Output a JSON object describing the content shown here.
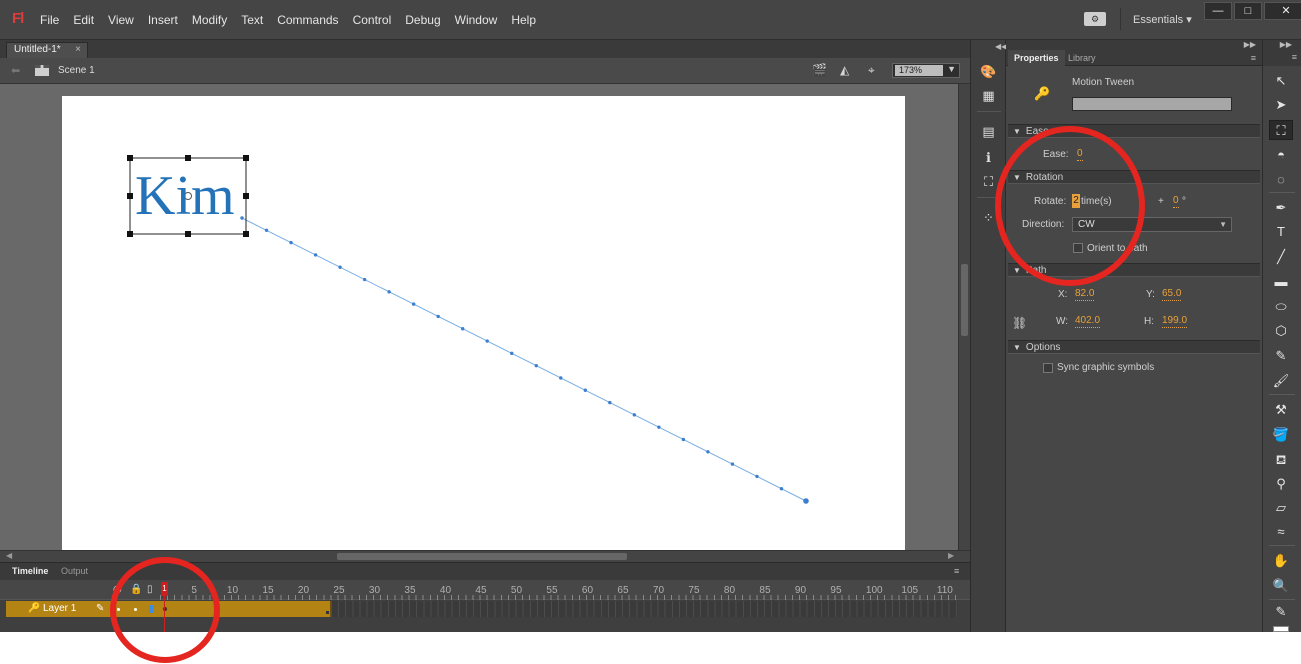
{
  "app": {
    "logo": "Fl",
    "menus": [
      "File",
      "Edit",
      "View",
      "Insert",
      "Modify",
      "Text",
      "Commands",
      "Control",
      "Debug",
      "Window",
      "Help"
    ],
    "workspace": "Essentials",
    "workspace_arrow": "▾",
    "window_buttons": {
      "minimize": "—",
      "maximize": "□",
      "close": "✕"
    }
  },
  "document": {
    "tab": "Untitled-1*",
    "tab_close": "×",
    "scene": "Scene 1",
    "zoom": "173%"
  },
  "stage": {
    "text": "Kim",
    "path_color": "#7aaee0",
    "text_color": "#2473b8"
  },
  "timeline": {
    "tabs": [
      "Timeline",
      "Output"
    ],
    "layer": "Layer 1",
    "playhead_frame": "1",
    "frame_labels": [
      "1",
      "5",
      "10",
      "15",
      "20",
      "25",
      "30",
      "35",
      "40",
      "45",
      "50",
      "55",
      "60",
      "65",
      "70",
      "75",
      "80",
      "85",
      "90",
      "95",
      "100",
      "105",
      "110"
    ],
    "tween_color": "#b38314"
  },
  "properties": {
    "tabs": [
      "Properties",
      "Library"
    ],
    "tween_type": "Motion Tween",
    "sections": {
      "ease": "Ease",
      "rotation": "Rotation",
      "path": "Path",
      "options": "Options"
    },
    "ease_label": "Ease:",
    "ease_value": "0",
    "rotate_label": "Rotate:",
    "rotate_count": "2",
    "rotate_unit": "time(s)",
    "rotate_plus": "+",
    "rotate_degrees": "0",
    "degree_sign": "°",
    "direction_label": "Direction:",
    "direction_value": "CW",
    "orient_label": "Orient to path",
    "x_label": "X:",
    "x_value": "82.0",
    "y_label": "Y:",
    "y_value": "65.0",
    "w_label": "W:",
    "w_value": "402.0",
    "h_label": "H:",
    "h_value": "199.0",
    "sync_label": "Sync graphic symbols"
  },
  "annotation_color": "#e5251f"
}
